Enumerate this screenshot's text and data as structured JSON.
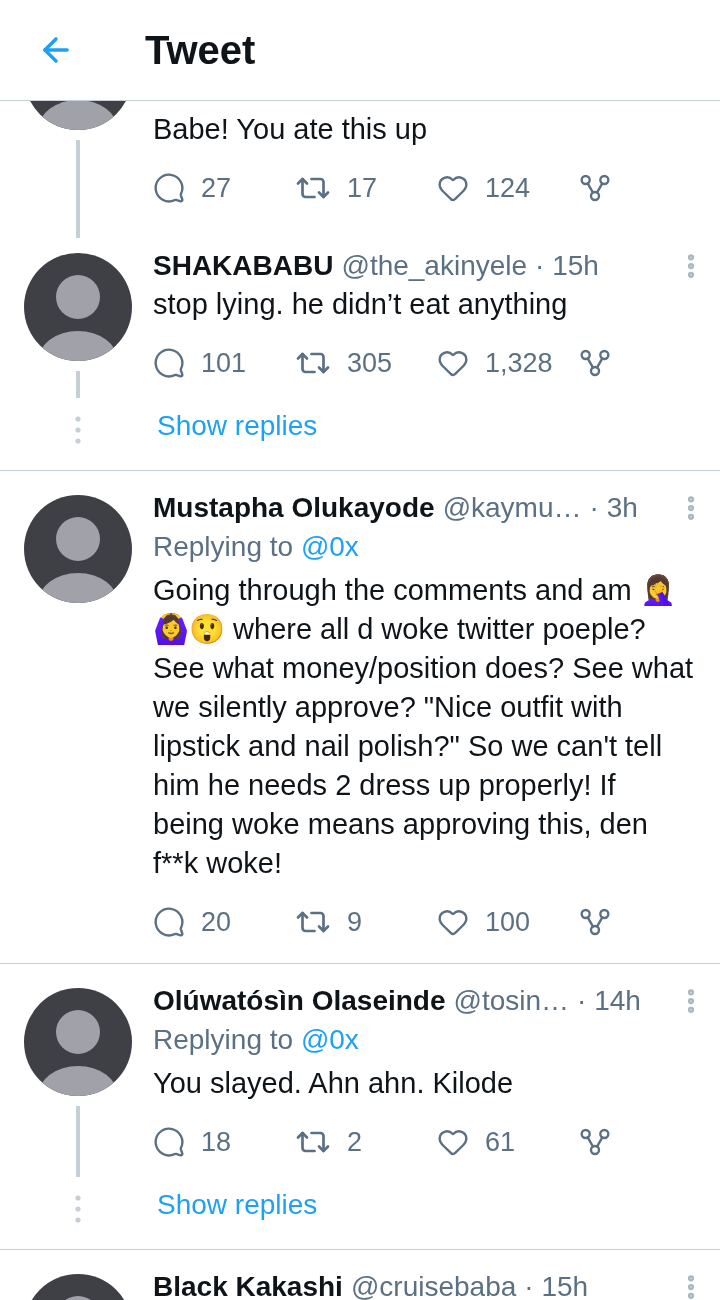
{
  "header": {
    "title": "Tweet"
  },
  "tweets": [
    {
      "kind": "continued",
      "text": "Babe! You ate this up",
      "replies": "27",
      "retweets": "17",
      "likes": "124",
      "thread_line": true,
      "divider_below": false
    },
    {
      "kind": "reply",
      "name": "SHAKABABU",
      "handle": "@the_akinyele",
      "time": "· 15h",
      "text": "stop lying. he didn’t eat anything",
      "replies": "101",
      "retweets": "305",
      "likes": "1,328",
      "thread_line": true,
      "show_replies": "Show replies",
      "divider_below": true
    },
    {
      "kind": "reply",
      "name": "Mustapha Olukayode",
      "handle": "@kaymu…",
      "time": "· 3h",
      "replying_prefix": "Replying to",
      "replying_to": "@0x",
      "text": "Going through the comments and am 🤦‍♀️🙆‍♀️😲 where all d woke twitter poeple? See what money/position does? See what we silently approve? \"Nice outfit with lipstick and nail polish?\" So we can't tell him he needs 2 dress up properly! If being woke means approving this, den f**k woke!",
      "replies": "20",
      "retweets": "9",
      "likes": "100",
      "thread_line": false,
      "divider_below": true
    },
    {
      "kind": "reply",
      "name": "Olúwatósìn Olaseinde",
      "handle": "@tosin…",
      "time": "· 14h",
      "replying_prefix": "Replying to",
      "replying_to": "@0x",
      "text": "You slayed. Ahn ahn. Kilode",
      "replies": "18",
      "retweets": "2",
      "likes": "61",
      "thread_line": true,
      "show_replies": "Show replies",
      "divider_below": true
    },
    {
      "kind": "reply",
      "name": "Black Kakashi",
      "handle": "@cruisebaba",
      "time": "· 15h",
      "thread_line": false,
      "divider_below": false
    }
  ]
}
